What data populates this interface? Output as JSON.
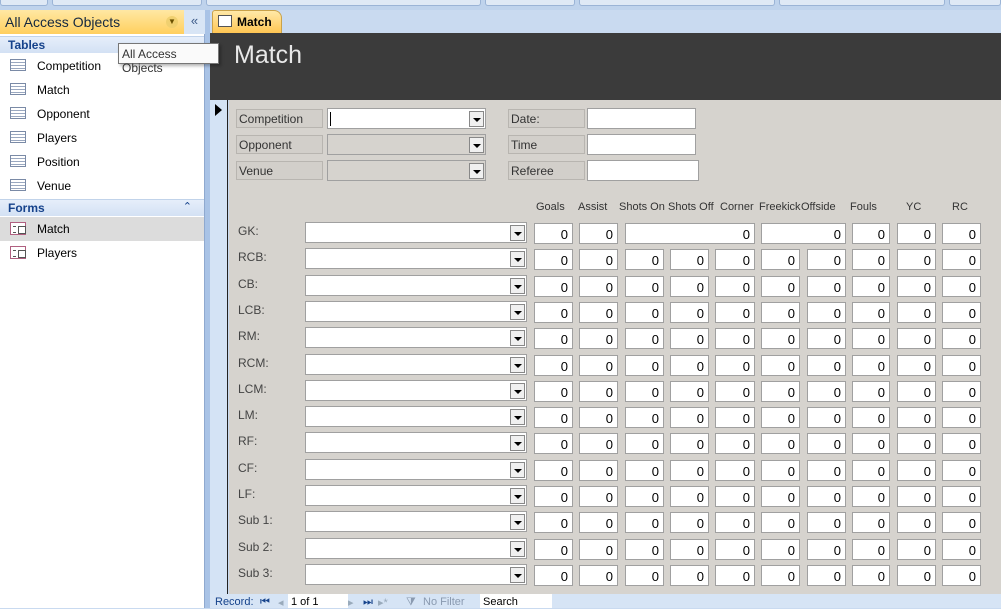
{
  "nav": {
    "title": "All Access Objects",
    "tooltip": "All Access Objects",
    "groups": [
      {
        "label": "Tables",
        "items": [
          "Competition",
          "Match",
          "Opponent",
          "Players",
          "Position",
          "Venue"
        ]
      },
      {
        "label": "Forms",
        "items": [
          "Match",
          "Players"
        ],
        "selected": "Match"
      }
    ]
  },
  "tab": {
    "label": "Match"
  },
  "form": {
    "title": "Match",
    "fields": {
      "competition": "Competition",
      "opponent": "Opponent",
      "venue": "Venue",
      "date": "Date:",
      "time": "Time",
      "referee": "Referee"
    },
    "columns": [
      "Goals",
      "Assist",
      "Shots On",
      "Shots Off",
      "Corner",
      "Freekick",
      "Offside",
      "Fouls",
      "YC",
      "RC"
    ],
    "positions": [
      "GK:",
      "RCB:",
      "CB:",
      "LCB:",
      "RM:",
      "RCM:",
      "LCM:",
      "LM:",
      "RF:",
      "CF:",
      "LF:",
      "Sub 1:",
      "Sub 2:",
      "Sub 3:"
    ],
    "gk_values": [
      "0",
      "0",
      "0",
      "0",
      "0",
      "0",
      "0"
    ],
    "row_values": [
      "0",
      "0",
      "0",
      "0",
      "0",
      "0",
      "0",
      "0",
      "0",
      "0"
    ]
  },
  "status": {
    "record_label": "Record:",
    "record_value": "1 of 1",
    "filter": "No Filter",
    "search": "Search"
  }
}
